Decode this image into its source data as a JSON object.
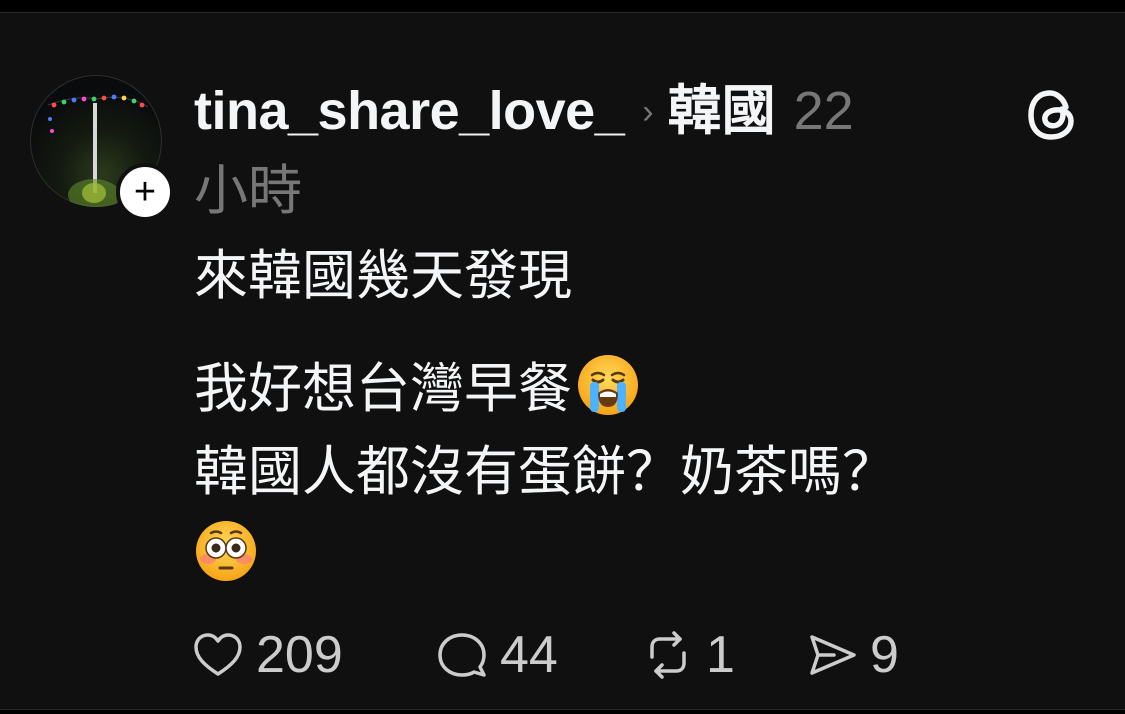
{
  "post": {
    "username": "tina_share_love_",
    "topic": "韓國",
    "time_part1": "22",
    "time_part2": "小時",
    "follow_symbol": "+",
    "body_lines": [
      "來韓國幾天發現",
      "我好想台灣早餐",
      "韓國人都沒有蛋餅？奶茶嗎？"
    ],
    "emojis": [
      "loudly-crying-face",
      "flushed-face"
    ],
    "stats": {
      "likes": "209",
      "replies": "44",
      "reposts": "1",
      "shares": "9"
    }
  },
  "icons": {
    "header": [
      "chevron-right-icon",
      "threads-logo-icon"
    ],
    "actions": [
      "heart-icon",
      "comment-icon",
      "repost-icon",
      "send-icon"
    ]
  },
  "colors": {
    "background": "#101010",
    "text_primary": "#f3f5f7",
    "text_secondary": "#777777",
    "action_text": "#cccccc"
  }
}
